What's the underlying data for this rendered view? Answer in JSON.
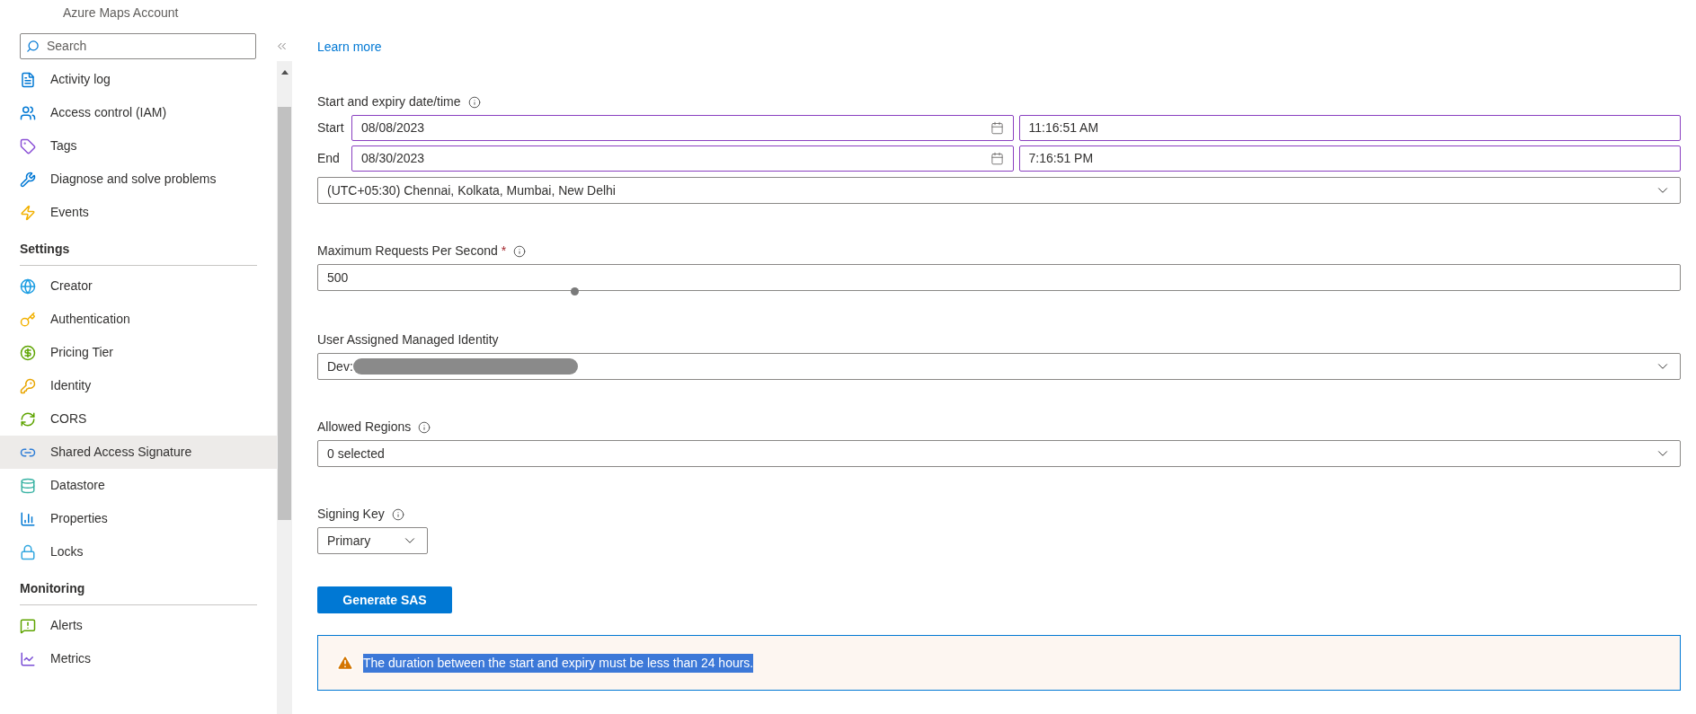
{
  "header": {
    "subtitle": "Azure Maps Account"
  },
  "sidebar": {
    "search": {
      "placeholder": "Search"
    },
    "sections": [
      {
        "items": [
          {
            "label": "Activity log",
            "selected": false
          },
          {
            "label": "Access control (IAM)",
            "selected": false
          },
          {
            "label": "Tags",
            "selected": false
          },
          {
            "label": "Diagnose and solve problems",
            "selected": false
          },
          {
            "label": "Events",
            "selected": false
          }
        ]
      },
      {
        "title": "Settings",
        "items": [
          {
            "label": "Creator",
            "selected": false
          },
          {
            "label": "Authentication",
            "selected": false
          },
          {
            "label": "Pricing Tier",
            "selected": false
          },
          {
            "label": "Identity",
            "selected": false
          },
          {
            "label": "CORS",
            "selected": false
          },
          {
            "label": "Shared Access Signature",
            "selected": true
          },
          {
            "label": "Datastore",
            "selected": false
          },
          {
            "label": "Properties",
            "selected": false
          },
          {
            "label": "Locks",
            "selected": false
          }
        ]
      },
      {
        "title": "Monitoring",
        "items": [
          {
            "label": "Alerts",
            "selected": false
          },
          {
            "label": "Metrics",
            "selected": false
          }
        ]
      }
    ]
  },
  "main": {
    "learn_more": "Learn more",
    "datetime": {
      "label": "Start and expiry date/time",
      "rows": [
        {
          "label": "Start",
          "date": "08/08/2023",
          "time": "11:16:51 AM"
        },
        {
          "label": "End",
          "date": "08/30/2023",
          "time": "7:16:51 PM"
        }
      ],
      "timezone": "(UTC+05:30) Chennai, Kolkata, Mumbai, New Delhi"
    },
    "max_requests": {
      "label": "Maximum Requests Per Second",
      "required_mark": "*",
      "value": "500"
    },
    "identity": {
      "label": "User Assigned Managed Identity",
      "value": "Dev:",
      "redacted": true
    },
    "regions": {
      "label": "Allowed Regions",
      "value": "0 selected"
    },
    "signing_key": {
      "label": "Signing Key",
      "value": "Primary"
    },
    "generate_button": "Generate SAS",
    "warning": {
      "message": "The duration between the start and expiry must be less than 24 hours.",
      "text_selected": true
    }
  }
}
